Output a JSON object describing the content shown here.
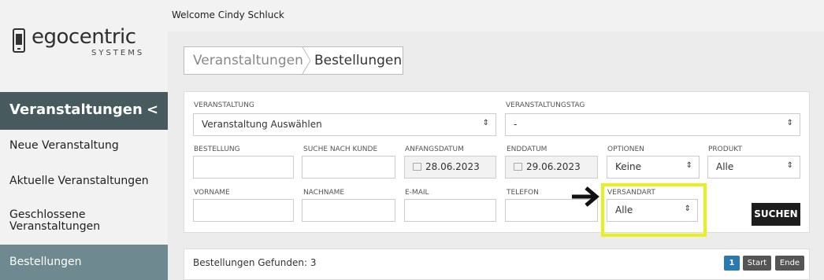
{
  "brand": {
    "name": "egocentric",
    "sub": "SYSTEMS"
  },
  "topbar": {
    "welcome": "Welcome Cindy Schluck"
  },
  "sidebar": {
    "section": "Veranstaltungen",
    "items": [
      {
        "label": "Neue Veranstaltung"
      },
      {
        "label": "Aktuelle Veranstaltungen"
      },
      {
        "label": "Geschlossene Veranstaltungen"
      },
      {
        "label": "Bestellungen"
      }
    ]
  },
  "breadcrumb": {
    "parent": "Veranstaltungen",
    "current": "Bestellungen"
  },
  "filters": {
    "veranstaltung": {
      "label": "VERANSTALTUNG",
      "value": "Veranstaltung Auswählen"
    },
    "veranstaltungstag": {
      "label": "VERANSTALTUNGSTAG",
      "value": "-"
    },
    "bestellung": {
      "label": "BESTELLUNG",
      "value": ""
    },
    "suche_kunde": {
      "label": "SUCHE NACH KUNDE",
      "value": ""
    },
    "anfangsdatum": {
      "label": "ANFANGSDATUM",
      "value": "28.06.2023"
    },
    "enddatum": {
      "label": "ENDDATUM",
      "value": "29.06.2023"
    },
    "optionen": {
      "label": "OPTIONEN",
      "value": "Keine"
    },
    "produkt": {
      "label": "PRODUKT",
      "value": "Alle"
    },
    "vorname": {
      "label": "VORNAME",
      "value": ""
    },
    "nachname": {
      "label": "NACHNAME",
      "value": ""
    },
    "email": {
      "label": "E-MAIL",
      "value": ""
    },
    "telefon": {
      "label": "TELEFON",
      "value": ""
    },
    "versandart": {
      "label": "VERSANDART",
      "value": "Alle"
    }
  },
  "search_button": "SUCHEN",
  "results": {
    "count_label": "Bestellungen Gefunden: 3",
    "pagination": {
      "page": "1",
      "start": "Start",
      "end": "Ende"
    }
  },
  "colors": {
    "sidebar_header": "#475a5e",
    "sidebar_active": "#6e8a90",
    "highlight": "#e6f01a",
    "page_button": "#2a7ab0"
  }
}
